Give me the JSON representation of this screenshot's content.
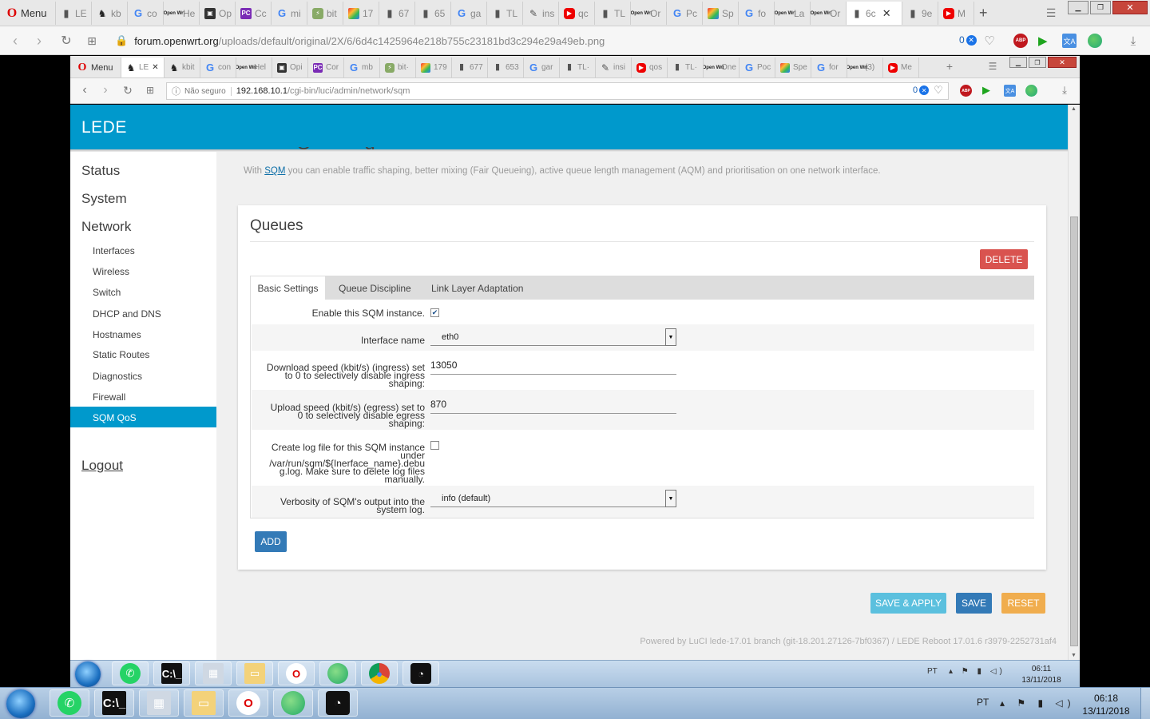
{
  "outer_browser": {
    "menu_label": "Menu",
    "tabs": [
      "LE",
      "kb",
      "co",
      "He",
      "Op",
      "Cc",
      "mi",
      "bit",
      "17",
      "67",
      "65",
      "ga",
      "TL",
      "ins",
      "qc",
      "TL",
      "Or",
      "Pc",
      "Sp",
      "fo",
      "La",
      "Or",
      "6c",
      "9e",
      "M"
    ],
    "address_host": "forum.openwrt.org",
    "address_path": "/uploads/default/original/2X/6/6d4c1425964e218b755c23181bd3c294e29a49eb.png",
    "badge_count": "0"
  },
  "inner_browser": {
    "menu_label": "Menu",
    "tabs": [
      "LE",
      "kbit",
      "con",
      "Hel",
      "Opi",
      "Cor",
      "mb",
      "bit·",
      "179",
      "677",
      "653",
      "gar",
      "TL·",
      "insi",
      "qos",
      "TL·",
      "One",
      "Poc",
      "Spe",
      "for",
      "(3)",
      "Me"
    ],
    "security_label": "Não seguro",
    "address_host": "192.168.10.1",
    "address_path": "/cgi-bin/luci/admin/network/sqm",
    "badge_count": "0"
  },
  "app": {
    "brand": "LEDE",
    "intro_link": "SQM",
    "intro_prefix": "With",
    "intro_rest": "you can enable traffic shaping, better mixing (Fair Queueing), active queue length management (AQM) and prioritisation on one network interface."
  },
  "sidebar": {
    "status": "Status",
    "system": "System",
    "network": "Network",
    "items": [
      "Interfaces",
      "Wireless",
      "Switch",
      "DHCP and DNS",
      "Hostnames",
      "Static Routes",
      "Diagnostics",
      "Firewall",
      "SQM QoS"
    ],
    "logout": "Logout"
  },
  "queues": {
    "title": "Queues",
    "delete": "DELETE",
    "tabs": [
      "Basic Settings",
      "Queue Discipline",
      "Link Layer Adaptation"
    ],
    "enable_label": "Enable this SQM instance.",
    "interface_label": "Interface name",
    "interface_value": "eth0",
    "download_label_1": "Download speed (kbit/s) (ingress) set",
    "download_label_2": "to 0 to selectively disable ingress",
    "download_label_3": "shaping:",
    "download_value": "13050",
    "upload_label_1": "Upload speed (kbit/s) (egress) set to",
    "upload_label_2": "0 to selectively disable egress",
    "upload_label_3": "shaping:",
    "upload_value": "870",
    "log_label_1": "Create log file for this SQM instance",
    "log_label_2": "under",
    "log_label_3": "/var/run/sqm/${Inerface_name}.debu",
    "log_label_4": "g.log. Make sure to delete log files",
    "log_label_5": "manually.",
    "verbosity_label_1": "Verbosity of SQM's output into the",
    "verbosity_label_2": "system log.",
    "verbosity_value": "info (default)",
    "add": "ADD"
  },
  "actions": {
    "save_apply": "SAVE & APPLY",
    "save": "SAVE",
    "reset": "RESET"
  },
  "footer": "Powered by LuCI lede-17.01 branch (git-18.201.27126-7bf0367) / LEDE Reboot 17.01.6 r3979-2252731af4",
  "inner_taskbar": {
    "lang": "PT",
    "time": "06:11",
    "date": "13/11/2018"
  },
  "outer_taskbar": {
    "lang": "PT",
    "time": "06:18",
    "date": "13/11/2018"
  },
  "colors": {
    "accent": "#0099cc",
    "delete": "#d9534f",
    "save_apply": "#5bc0de",
    "save": "#337ab7",
    "reset": "#f0ad4e"
  }
}
